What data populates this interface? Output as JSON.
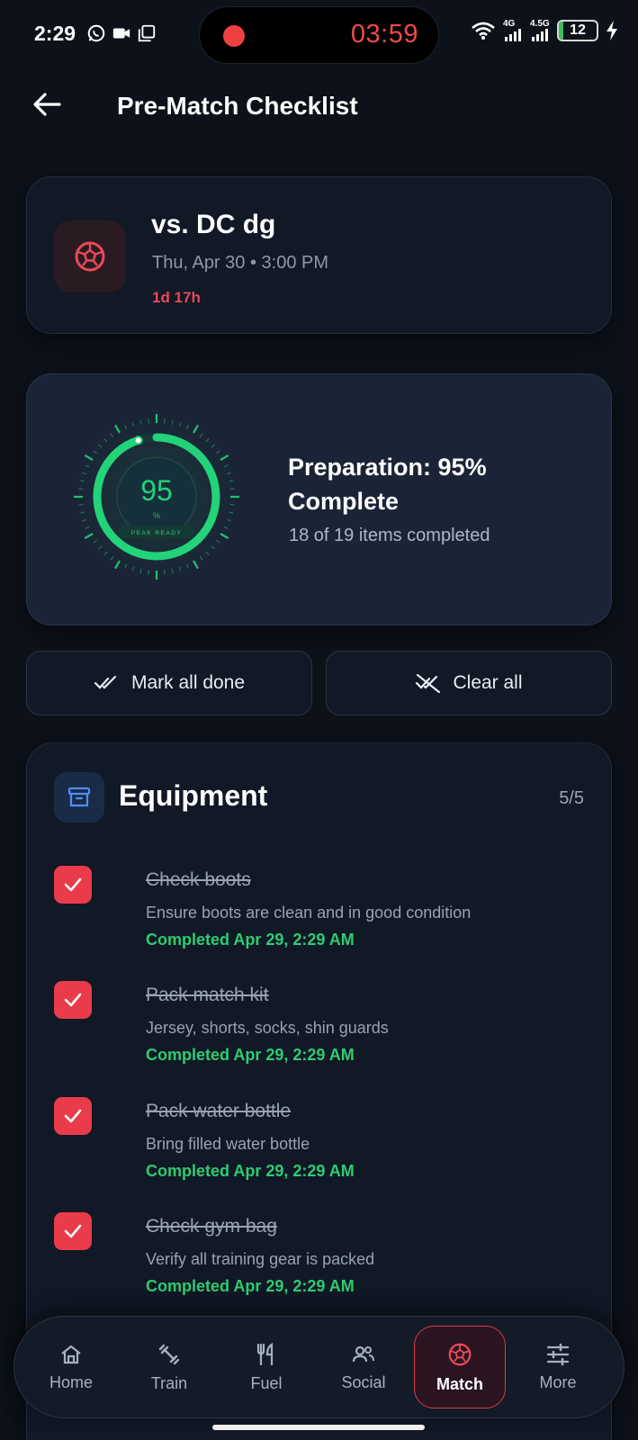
{
  "status_bar": {
    "time": "2:29",
    "recording_timer": "03:59",
    "net1": "4G",
    "net2": "4.5G",
    "battery": "12",
    "battery_level": 0.12,
    "icons": [
      "whatsapp-icon",
      "video-icon",
      "copy-icon",
      "wifi-icon",
      "signal-icon",
      "signal-icon",
      "battery-icon",
      "charging-bolt-icon"
    ]
  },
  "header": {
    "title": "Pre-Match Checklist",
    "back_icon": "arrow-left-icon"
  },
  "match": {
    "opponent": "vs. DC dg",
    "datetime": "Thu, Apr 30 • 3:00 PM",
    "countdown": "1d 17h",
    "icon": "soccer-ball-icon",
    "accent": "#e84a57"
  },
  "preparation": {
    "gauge_value": "95",
    "gauge_unit": "%",
    "gauge_caption": "PEAK READY",
    "percent": 95,
    "title": "Preparation: 95% Complete",
    "subtitle": "18 of 19 items completed",
    "gauge_color": "#22d37a"
  },
  "actions": {
    "mark_all": "Mark all done",
    "clear_all": "Clear all"
  },
  "equipment": {
    "title": "Equipment",
    "count": "5/5",
    "items": [
      {
        "title": "Check boots",
        "desc": "Ensure boots are clean and in good condition",
        "done": "Completed Apr 29, 2:29 AM"
      },
      {
        "title": "Pack match kit",
        "desc": "Jersey, shorts, socks, shin guards",
        "done": "Completed Apr 29, 2:29 AM"
      },
      {
        "title": "Pack water bottle",
        "desc": "Bring filled water bottle",
        "done": "Completed Apr 29, 2:29 AM"
      },
      {
        "title": "Check gym bag",
        "desc": "Verify all training gear is packed",
        "done": "Completed Apr 29, 2:29 AM"
      }
    ]
  },
  "nav": {
    "items": [
      {
        "label": "Home",
        "icon": "home-icon"
      },
      {
        "label": "Train",
        "icon": "dumbbell-icon"
      },
      {
        "label": "Fuel",
        "icon": "utensils-icon"
      },
      {
        "label": "Social",
        "icon": "users-icon"
      },
      {
        "label": "Match",
        "icon": "soccer-ball-icon"
      },
      {
        "label": "More",
        "icon": "sliders-icon"
      }
    ],
    "active": "Match"
  },
  "colors": {
    "background": "#0c111a",
    "card": "#111826",
    "accent_red": "#ea3b4a",
    "success_green": "#2ecc71"
  }
}
